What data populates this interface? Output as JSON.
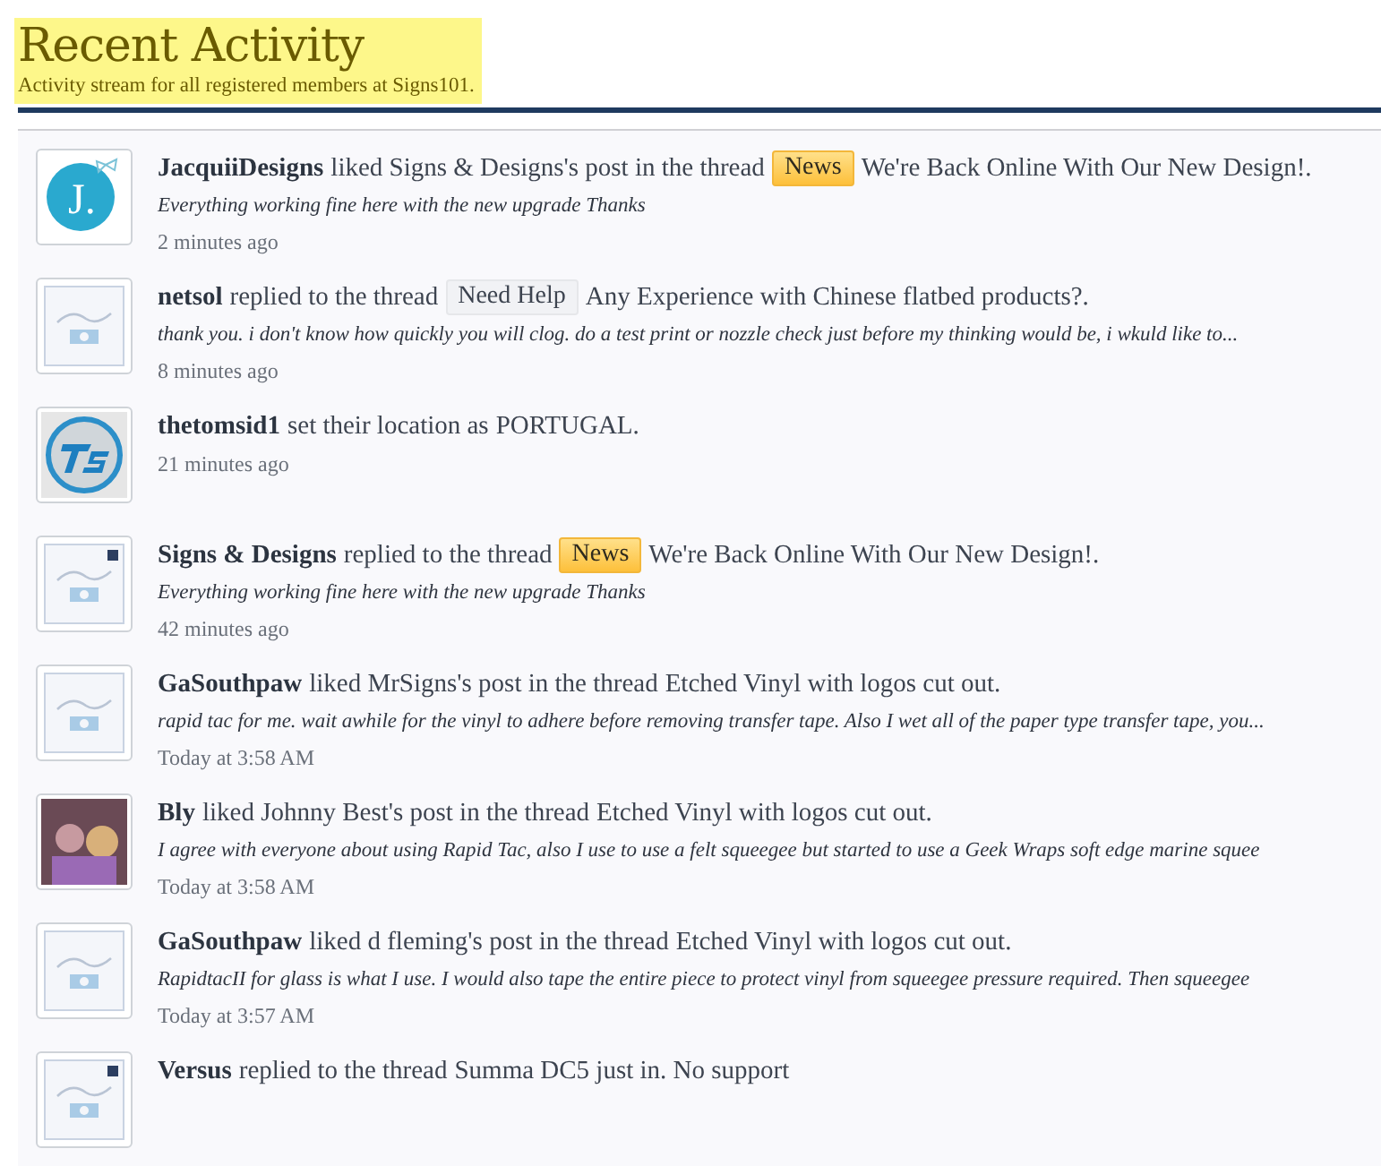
{
  "header": {
    "title": "Recent Activity",
    "subtitle": "Activity stream for all registered members at Signs101."
  },
  "items": [
    {
      "avatar": {
        "kind": "letter",
        "letter": "J.",
        "dot": false
      },
      "user": "JacquiiDesigns",
      "action": "liked Signs & Designs's post in the thread",
      "prefix": {
        "text": "News",
        "kind": "news"
      },
      "target": "We're Back Online With Our New Design!.",
      "snippet": "Everything working fine here with the new upgrade Thanks",
      "time": "2 minutes ago"
    },
    {
      "avatar": {
        "kind": "signs",
        "dot": false
      },
      "user": "netsol",
      "action": "replied to the thread",
      "prefix": {
        "text": "Need Help",
        "kind": "plain"
      },
      "target": "Any Experience with Chinese flatbed products?.",
      "snippet": "thank you. i don't know how quickly you will clog. do a test print or nozzle check just before my thinking would be, i wkuld like to...",
      "time": "8 minutes ago"
    },
    {
      "avatar": {
        "kind": "ts",
        "dot": false
      },
      "user": "thetomsid1",
      "action": "set their location as",
      "target": "PORTUGAL.",
      "time": "21 minutes ago"
    },
    {
      "avatar": {
        "kind": "signs",
        "dot": true
      },
      "user": "Signs & Designs",
      "action": "replied to the thread",
      "prefix": {
        "text": "News",
        "kind": "news"
      },
      "target": "We're Back Online With Our New Design!.",
      "snippet": "Everything working fine here with the new upgrade Thanks",
      "time": "42 minutes ago"
    },
    {
      "avatar": {
        "kind": "signs",
        "dot": false
      },
      "user": "GaSouthpaw",
      "action": "liked MrSigns's post in the thread",
      "target": "Etched Vinyl with logos cut out.",
      "snippet": "rapid tac for me. wait awhile for the vinyl to adhere before removing transfer tape. Also I wet all of the paper type transfer tape, you...",
      "time": "Today at 3:58 AM"
    },
    {
      "avatar": {
        "kind": "photo",
        "dot": false
      },
      "user": "Bly",
      "action": "liked Johnny Best's post in the thread",
      "target": "Etched Vinyl with logos cut out.",
      "snippet": "I agree with everyone about using Rapid Tac, also I use to use a felt squeegee but started to use a Geek Wraps soft edge marine squee",
      "time": "Today at 3:58 AM"
    },
    {
      "avatar": {
        "kind": "signs",
        "dot": false
      },
      "user": "GaSouthpaw",
      "action": "liked d fleming's post in the thread",
      "target": "Etched Vinyl with logos cut out.",
      "snippet": "RapidtacII for glass is what I use. I would also tape the entire piece to protect vinyl from squeegee pressure required. Then squeegee",
      "time": "Today at 3:57 AM"
    },
    {
      "avatar": {
        "kind": "signs",
        "dot": true
      },
      "user": "Versus",
      "action": "replied to the thread",
      "target": "Summa DC5 just in. No support"
    }
  ]
}
